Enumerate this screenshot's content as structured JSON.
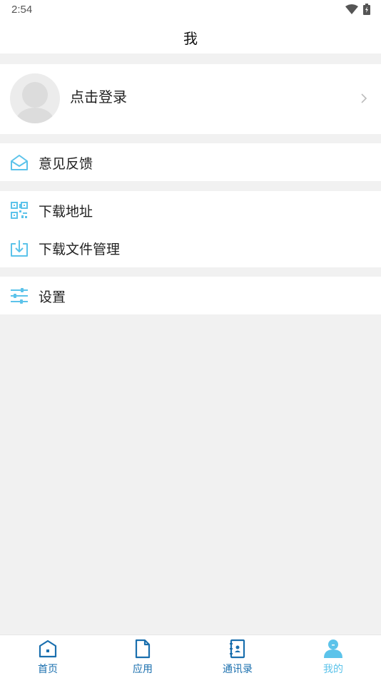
{
  "status_bar": {
    "time": "2:54",
    "wifi_icon": "wifi-icon",
    "battery_icon": "battery-charging-icon"
  },
  "header": {
    "title": "我"
  },
  "profile": {
    "login_text": "点击登录",
    "avatar_icon": "avatar-placeholder-icon",
    "chevron_icon": "chevron-right-icon"
  },
  "menu_groups": [
    [
      {
        "label": "意见反馈",
        "icon": "mail-open-icon"
      }
    ],
    [
      {
        "label": "下载地址",
        "icon": "qr-code-icon"
      },
      {
        "label": "下载文件管理",
        "icon": "download-icon"
      }
    ],
    [
      {
        "label": "设置",
        "icon": "sliders-icon"
      }
    ]
  ],
  "bottom_nav": [
    {
      "label": "首页",
      "icon": "home-icon",
      "active": false
    },
    {
      "label": "应用",
      "icon": "document-icon",
      "active": false
    },
    {
      "label": "通讯录",
      "icon": "contacts-icon",
      "active": false
    },
    {
      "label": "我的",
      "icon": "user-icon",
      "active": true
    }
  ],
  "colors": {
    "accent": "#5cc3ea",
    "nav_inactive": "#1a6fae",
    "background": "#f1f1f1"
  }
}
